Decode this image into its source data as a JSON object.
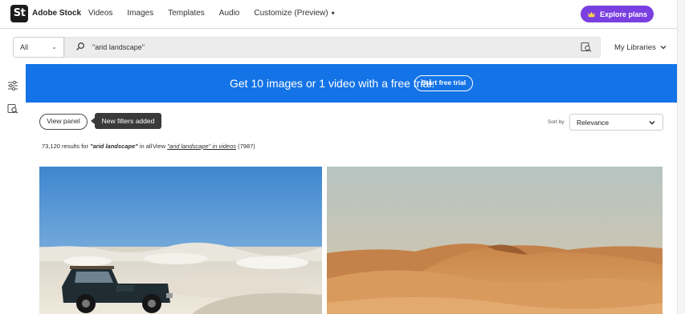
{
  "app": {
    "logo_text": "St",
    "brand": "Adobe Stock"
  },
  "nav": {
    "items": [
      {
        "label": "Videos"
      },
      {
        "label": "Images"
      },
      {
        "label": "Templates"
      },
      {
        "label": "Audio"
      },
      {
        "label": "Customize (Preview)"
      }
    ],
    "customize_sparkle": "✦",
    "explore_label": "Explore plans",
    "explore_icon": "crown-icon",
    "accent_color": "#7a3fe0"
  },
  "search": {
    "scope_value": "All",
    "query": "\"arid landscape\"",
    "search_icon": "search-icon",
    "visual_search_icon": "visual-search-icon",
    "libraries_label": "My Libraries"
  },
  "rail": {
    "icons": [
      "filters-icon",
      "visual-search-icon"
    ]
  },
  "banner": {
    "text": "Get 10 images or 1 video with a free trial.",
    "button_label": "Start free trial",
    "background": "#1473e6"
  },
  "filters": {
    "view_panel_label": "View panel",
    "tooltip": "New filters added",
    "sort_label": "Sort by",
    "sort_value": "Relevance"
  },
  "results": {
    "count": "73,120",
    "prefix": "results for",
    "query": "\"arid landscape\"",
    "suffix": "in all",
    "view_prefix": "View",
    "video_link": "\"arid landscape\" in videos",
    "video_count": "(7987)"
  },
  "images": [
    {
      "subject": "desert-with-suv"
    },
    {
      "subject": "sand-dunes"
    }
  ]
}
